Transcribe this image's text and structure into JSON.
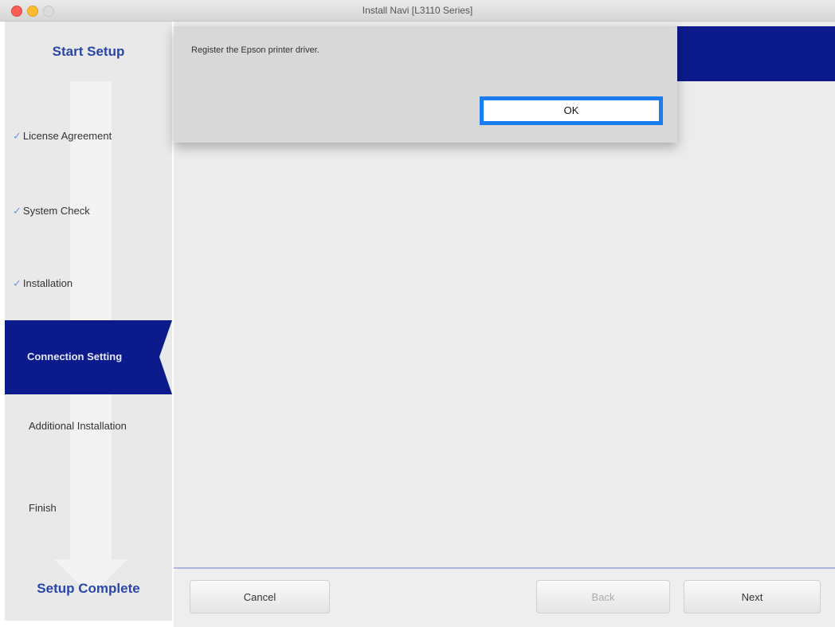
{
  "window": {
    "title": "Install Navi [L3110 Series]"
  },
  "sidebar": {
    "start_title": "Start Setup",
    "steps": [
      {
        "label": "License Agreement",
        "completed": true
      },
      {
        "label": "System Check",
        "completed": true
      },
      {
        "label": "Installation",
        "completed": true
      },
      {
        "label": "Connection Setting",
        "active": true
      },
      {
        "label": "Additional Installation",
        "completed": false
      },
      {
        "label": "Finish",
        "completed": false
      }
    ],
    "checkmark": "✓",
    "end_title": "Setup Complete"
  },
  "dialog": {
    "message": "Register the Epson printer driver.",
    "ok_label": "OK"
  },
  "footer": {
    "cancel_label": "Cancel",
    "back_label": "Back",
    "next_label": "Next"
  },
  "colors": {
    "accent": "#0b1b8c",
    "focus": "#1a7ef2",
    "step_title": "#2946a8"
  }
}
